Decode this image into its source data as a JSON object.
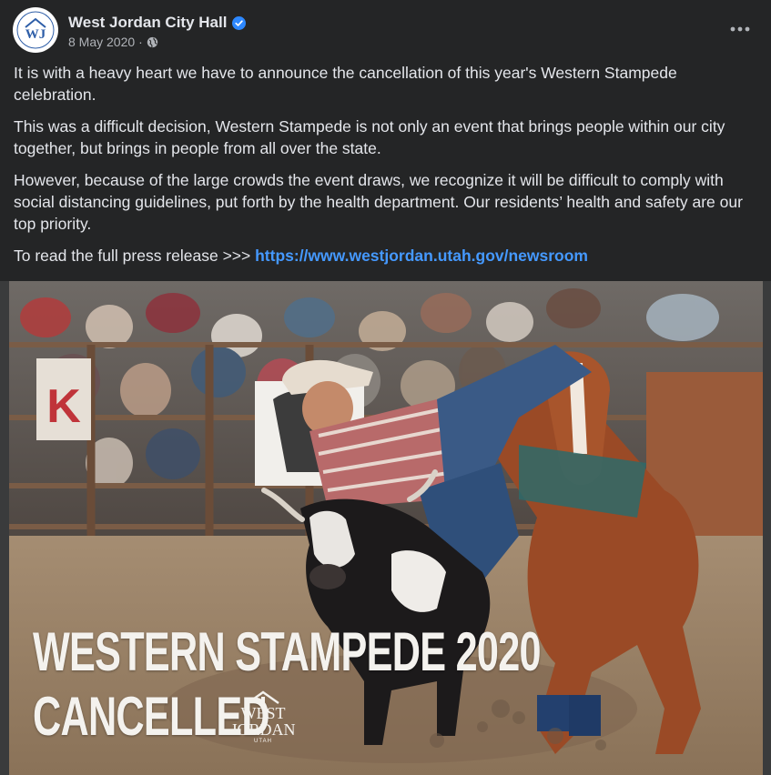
{
  "post": {
    "page_name": "West Jordan City Hall",
    "avatar_text": "WJ",
    "date": "8 May 2020",
    "separator": " · ",
    "privacy_icon": "globe-icon",
    "verified_icon": "verified-badge-icon",
    "more_icon": "more-options-icon",
    "paragraphs": [
      "It is with a heavy heart we have to announce the cancellation of this year's Western Stampede celebration.",
      "This was a difficult decision, Western Stampede is not only an event that brings people within our city together, but brings in people from all over the state.",
      "However, because of the large crowds the event draws, we recognize it will be difficult to comply with social distancing guidelines, put forth by the health department. Our residents’ health and safety are our top priority."
    ],
    "press_release_prefix": "To read the full press release >>> ",
    "press_release_link": "https://www.westjordan.utah.gov/newsroom"
  },
  "image": {
    "title_line": "WESTERN STAMPEDE 2020",
    "status_line": "CANCELLED",
    "logo_line1": "WEST",
    "logo_line2": "JORDAN",
    "logo_line3": "UTAH",
    "sign_letter": "K"
  },
  "colors": {
    "background": "#242526",
    "text": "#e4e6eb",
    "secondary_text": "#b0b3b8",
    "link": "#4599ff",
    "verified": "#2d88ff"
  }
}
